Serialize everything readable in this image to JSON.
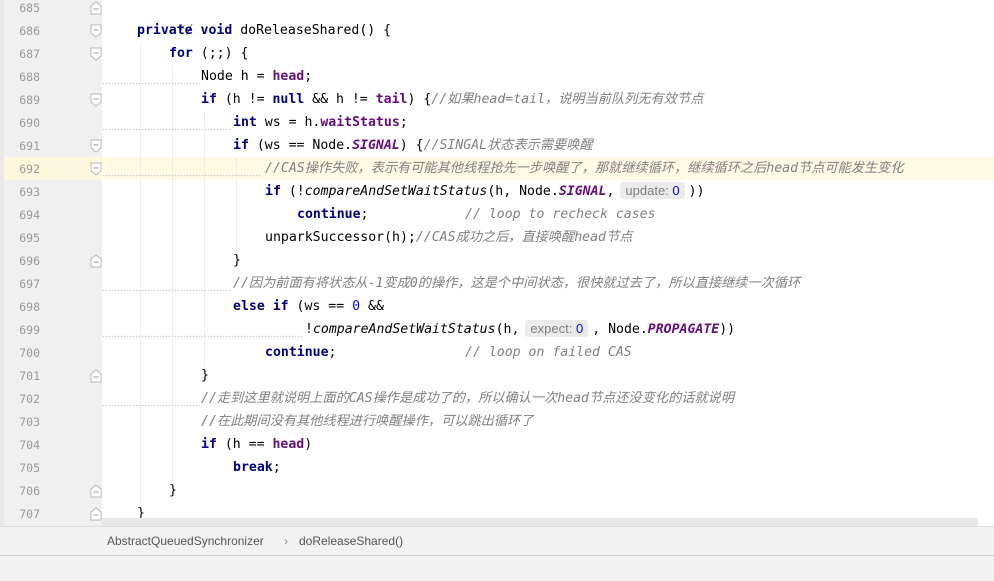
{
  "editor": {
    "line_numbers": [
      "685",
      "686",
      "687",
      "688",
      "689",
      "690",
      "691",
      "692",
      "693",
      "694",
      "695",
      "696",
      "697",
      "698",
      "699",
      "700",
      "701",
      "702",
      "703",
      "704",
      "705",
      "706",
      "707"
    ],
    "code": {
      "l685": {
        "comment_end": "*/"
      },
      "l686": {
        "private": "private",
        "void": "void",
        "name": " doReleaseShared() {"
      },
      "l687": {
        "for": "for",
        "rest": " (;;) {"
      },
      "l688": {
        "pre": "Node h = ",
        "head": "head",
        "post": ";"
      },
      "l689": {
        "if": "if",
        "a": " (h != ",
        "null": "null",
        "b": " && h != ",
        "tail": "tail",
        "c": ") {",
        "comment": "//如果head=tail，说明当前队列无有效节点"
      },
      "l690": {
        "int": "int",
        "a": " ws = h.",
        "field": "waitStatus",
        "b": ";"
      },
      "l691": {
        "if": "if",
        "a": " (ws == Node.",
        "signal": "SIGNAL",
        "b": ") {",
        "comment": "//SINGAL状态表示需要唤醒"
      },
      "l692": {
        "comment": "//CAS操作失败，表示有可能其他线程抢先一步唤醒了，那就继续循环，继续循环之后head节点可能发生变化"
      },
      "l693": {
        "if": "if",
        "a": " (!",
        "method": "compareAndSetWaitStatus",
        "b": "(h, Node.",
        "signal": "SIGNAL",
        "c": ",",
        "hint_name": "update:",
        "hint_value": "0",
        "d": "))"
      },
      "l694": {
        "continue": "continue",
        "a": ";",
        "comment": "// loop to recheck cases"
      },
      "l695": {
        "a": "unparkSuccessor(h);",
        "comment": "//CAS成功之后，直接唤醒head节点"
      },
      "l696": {
        "a": "}"
      },
      "l697": {
        "comment": "//因为前面有将状态从-1变成0的操作，这是个中间状态，很快就过去了，所以直接继续一次循环"
      },
      "l698": {
        "else": "else",
        "if": "if",
        "a": " (ws == ",
        "zero": "0",
        "b": " &&"
      },
      "l699": {
        "a": "!",
        "method": "compareAndSetWaitStatus",
        "b": "(h,",
        "hint_name": "expect:",
        "hint_value": "0",
        "c": ", Node.",
        "propagate": "PROPAGATE",
        "d": "))"
      },
      "l700": {
        "continue": "continue",
        "a": ";",
        "comment": "// loop on failed CAS"
      },
      "l701": {
        "a": "}"
      },
      "l702": {
        "comment": "//走到这里就说明上面的CAS操作是成功了的，所以确认一次head节点还没变化的话就说明"
      },
      "l703": {
        "comment": "//在此期间没有其他线程进行唤醒操作，可以跳出循环了"
      },
      "l704": {
        "if": "if",
        "a": " (h == ",
        "head": "head",
        "b": ")"
      },
      "l705": {
        "break": "break",
        "a": ";"
      },
      "l706": {
        "a": "}"
      },
      "l707": {
        "a": "}"
      }
    },
    "current_line": "692"
  },
  "breadcrumb": {
    "class_name": "AbstractQueuedSynchronizer",
    "separator": "›",
    "method_name": "doReleaseShared()"
  },
  "colors": {
    "keyword": "#000080",
    "field": "#660e7a",
    "comment": "#808080",
    "number": "#0000ff",
    "current_line": "#fffae3"
  }
}
